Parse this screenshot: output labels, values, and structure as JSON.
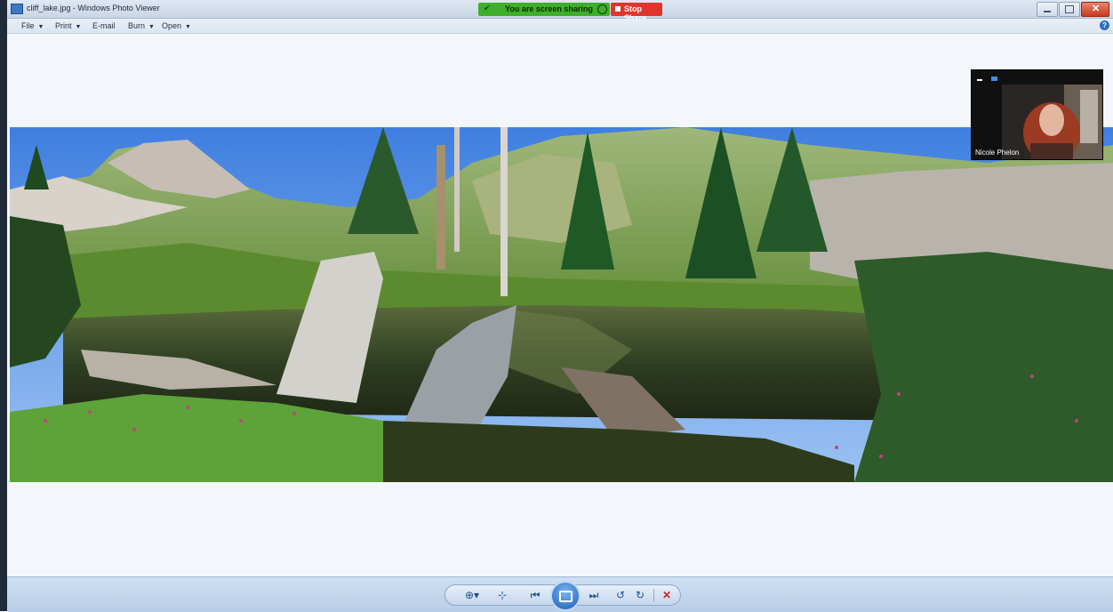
{
  "window": {
    "title": "cliff_lake.jpg - Windows Photo Viewer"
  },
  "screen_share": {
    "status_text": "You are screen sharing",
    "stop_label": "Stop Share",
    "status_color": "#3fae2a",
    "stop_color": "#e0342c"
  },
  "menu": {
    "file": "File",
    "print": "Print",
    "email": "E-mail",
    "burn": "Burn",
    "open": "Open"
  },
  "video": {
    "participant_name": "Nicole Phelon"
  },
  "toolbar": {
    "buttons": [
      "magnifier-icon",
      "actual-size-icon",
      "previous-icon",
      "slideshow-icon",
      "next-icon",
      "rotate-ccw-icon",
      "rotate-cw-icon",
      "delete-icon"
    ]
  },
  "colors": {
    "accent": "#2c6fc2",
    "viewer_bg": "#f3f7fc"
  }
}
